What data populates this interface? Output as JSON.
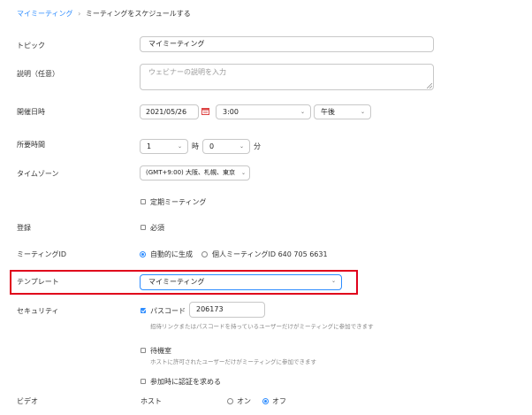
{
  "breadcrumb": {
    "parent": "マイミーティング",
    "separator": "›",
    "current": "ミーティングをスケジュールする"
  },
  "topic": {
    "label": "トピック",
    "value": "マイミーティング"
  },
  "description": {
    "label": "説明（任意）",
    "placeholder": "ウェビナーの説明を入力"
  },
  "datetime": {
    "label": "開催日時",
    "date": "2021/05/26",
    "time": "3:00",
    "ampm": "午後"
  },
  "duration": {
    "label": "所要時間",
    "hours": "1",
    "hours_unit": "時",
    "minutes": "0",
    "minutes_unit": "分"
  },
  "timezone": {
    "label": "タイムゾーン",
    "value": "(GMT+9:00) 大阪、札幌、東京"
  },
  "recurring": {
    "label": "定期ミーティング",
    "checked": false
  },
  "registration": {
    "label": "登録",
    "option_label": "必須",
    "checked": false
  },
  "meeting_id": {
    "label": "ミーティングID",
    "option_auto": "自動的に生成",
    "option_personal": "個人ミーティングID 640 705 6631",
    "selected": "auto"
  },
  "template": {
    "label": "テンプレート",
    "value": "マイミーティング"
  },
  "security": {
    "label": "セキュリティ",
    "passcode_label": "パスコード",
    "passcode_value": "206173",
    "passcode_note": "招待リンクまたはパスコードを持っているユーザーだけがミーティングに参加できます",
    "waiting_room_label": "待機室",
    "waiting_room_note": "ホストに許可されたユーザーだけがミーティングに参加できます",
    "auth_label": "参加時に認証を求める"
  },
  "video": {
    "label": "ビデオ",
    "host_label": "ホスト",
    "on_label": "オン",
    "off_label": "オフ",
    "selected": "off"
  },
  "colors": {
    "accent": "#2d8cff",
    "highlight": "#e0001b"
  },
  "icons": {
    "calendar": "calendar-icon",
    "chevron": "chevron-down-icon"
  }
}
